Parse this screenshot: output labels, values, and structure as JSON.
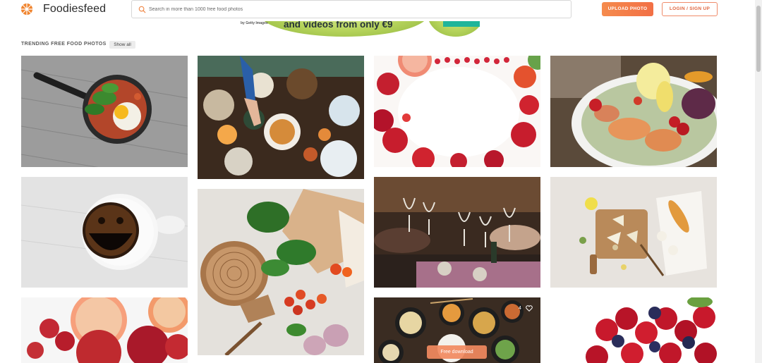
{
  "header": {
    "brand": "Foodiesfeed",
    "search_placeholder": "Search in more than 1000 free food photos",
    "upload_label": "UPLOAD PHOTO",
    "login_label": "LOGIN / SIGN UP"
  },
  "ad": {
    "provider": "by Getty Images",
    "headline": "and videos from only €9"
  },
  "section": {
    "title": "TRENDING FREE FOOD PHOTOS",
    "show_all": "Show all"
  },
  "photos": [
    {
      "subject": "fried egg with spinach in cast iron skillet"
    },
    {
      "subject": "table spread with hands and bowls"
    },
    {
      "subject": "berries and fruit frame"
    },
    {
      "subject": "salmon salad with lemon"
    },
    {
      "subject": "smiling coffee cup"
    },
    {
      "subject": "bread, tomatoes and herbs on table"
    },
    {
      "subject": "wine glasses toast"
    },
    {
      "subject": "cheese board with baguette"
    },
    {
      "subject": "grapefruit and apples"
    },
    {
      "subject": "sushi and small bowls",
      "likes": "4",
      "download_label": "Free download"
    },
    {
      "subject": "strawberries and blueberries"
    }
  ],
  "colors": {
    "accent": "#f26f45",
    "upload_bg": "#f58b4d",
    "login_border": "#ef8b6a"
  },
  "icons": [
    "logo-icon",
    "search-icon",
    "heart-icon"
  ]
}
